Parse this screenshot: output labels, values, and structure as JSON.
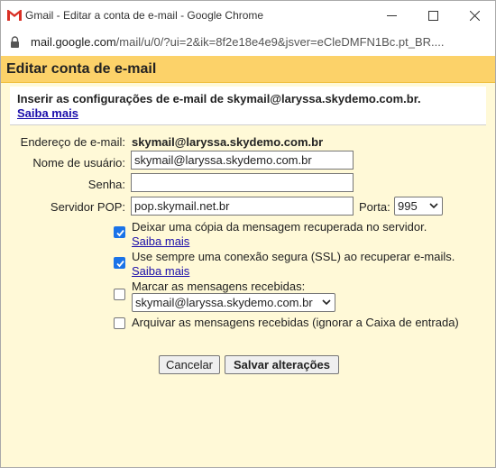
{
  "window": {
    "title": "Gmail - Editar a conta de e-mail - Google Chrome",
    "url_host": "mail.google.com",
    "url_rest": "/mail/u/0/?ui=2&ik=8f2e18e4e9&jsver=eCleDMFN1Bc.pt_BR...."
  },
  "dialog": {
    "title": "Editar conta de e-mail",
    "intro": "Inserir as configurações de e-mail de skymail@laryssa.skydemo.com.br.",
    "learn_more": "Saiba mais"
  },
  "form": {
    "email_label": "Endereço de e-mail:",
    "email_value": "skymail@laryssa.skydemo.com.br",
    "username_label": "Nome de usuário:",
    "username_value": "skymail@laryssa.skydemo.com.br",
    "password_label": "Senha:",
    "password_value": "",
    "pop_label": "Servidor POP:",
    "pop_value": "pop.skymail.net.br",
    "port_label": "Porta:",
    "port_value": "995"
  },
  "options": {
    "leave_copy": {
      "label": "Deixar uma cópia da mensagem recuperada no servidor.",
      "link": "Saiba mais",
      "checked": true
    },
    "ssl": {
      "label": "Use sempre uma conexão segura (SSL) ao recuperar e-mails.",
      "link": "Saiba mais",
      "checked": true
    },
    "label_incoming": {
      "label": "Marcar as mensagens recebidas:",
      "select_value": "skymail@laryssa.skydemo.com.br",
      "checked": false
    },
    "archive": {
      "label": "Arquivar as mensagens recebidas (ignorar a Caixa de entrada)",
      "checked": false
    }
  },
  "buttons": {
    "cancel": "Cancelar",
    "save": "Salvar alterações"
  },
  "colors": {
    "header_bg": "#fcd269",
    "body_bg": "#fff9d7",
    "checkbox": "#1a73e8",
    "link": "#1a0dab"
  }
}
